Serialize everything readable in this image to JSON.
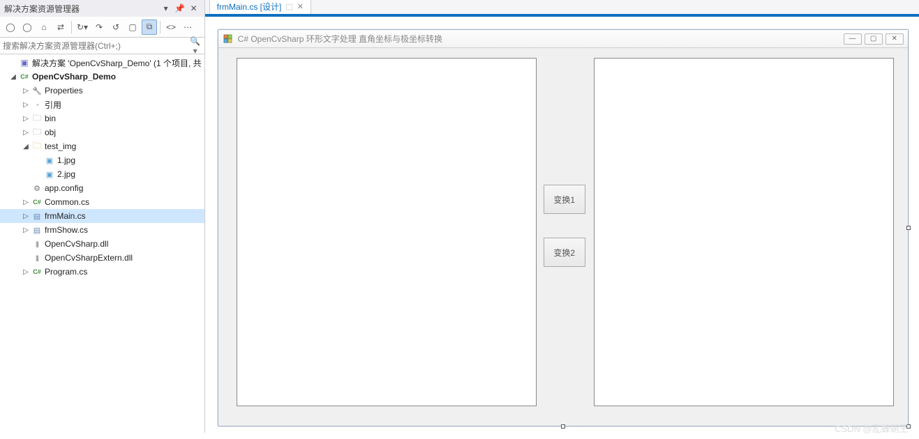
{
  "solutionExplorer": {
    "title": "解决方案资源管理器",
    "searchPlaceholder": "搜索解决方案资源管理器(Ctrl+;)",
    "toolbarIcons": [
      "back",
      "fwd",
      "home",
      "sync",
      "refresh",
      "collapse",
      "restore",
      "show-all",
      "view-code",
      "properties"
    ],
    "tree": [
      {
        "depth": 0,
        "arrow": "none",
        "iconCls": "ico-sol",
        "label": "解决方案 'OpenCvSharp_Demo' (1 个项目, 共",
        "bold": false,
        "sel": false
      },
      {
        "depth": 0,
        "arrow": "open",
        "iconCls": "ico-cs",
        "label": "OpenCvSharp_Demo",
        "bold": true,
        "sel": false
      },
      {
        "depth": 1,
        "arrow": "closed",
        "iconCls": "ico-prop",
        "label": "Properties",
        "bold": false,
        "sel": false
      },
      {
        "depth": 1,
        "arrow": "closed",
        "iconCls": "ico-ref",
        "label": "引用",
        "bold": false,
        "sel": false
      },
      {
        "depth": 1,
        "arrow": "closed",
        "iconCls": "ico-folderd",
        "label": "bin",
        "bold": false,
        "sel": false
      },
      {
        "depth": 1,
        "arrow": "closed",
        "iconCls": "ico-folderd",
        "label": "obj",
        "bold": false,
        "sel": false
      },
      {
        "depth": 1,
        "arrow": "open",
        "iconCls": "ico-folder",
        "label": "test_img",
        "bold": false,
        "sel": false
      },
      {
        "depth": 2,
        "arrow": "none",
        "iconCls": "ico-img",
        "label": "1.jpg",
        "bold": false,
        "sel": false
      },
      {
        "depth": 2,
        "arrow": "none",
        "iconCls": "ico-img",
        "label": "2.jpg",
        "bold": false,
        "sel": false
      },
      {
        "depth": 1,
        "arrow": "none",
        "iconCls": "ico-cfg",
        "label": "app.config",
        "bold": false,
        "sel": false
      },
      {
        "depth": 1,
        "arrow": "closed",
        "iconCls": "ico-cs",
        "label": "Common.cs",
        "bold": false,
        "sel": false
      },
      {
        "depth": 1,
        "arrow": "closed",
        "iconCls": "ico-form",
        "label": "frmMain.cs",
        "bold": false,
        "sel": true
      },
      {
        "depth": 1,
        "arrow": "closed",
        "iconCls": "ico-form",
        "label": "frmShow.cs",
        "bold": false,
        "sel": false
      },
      {
        "depth": 1,
        "arrow": "none",
        "iconCls": "ico-dll",
        "label": "OpenCvSharp.dll",
        "bold": false,
        "sel": false
      },
      {
        "depth": 1,
        "arrow": "none",
        "iconCls": "ico-dll",
        "label": "OpenCvSharpExtern.dll",
        "bold": false,
        "sel": false
      },
      {
        "depth": 1,
        "arrow": "closed",
        "iconCls": "ico-cs",
        "label": "Program.cs",
        "bold": false,
        "sel": false
      }
    ]
  },
  "editor": {
    "tabLabel": "frmMain.cs [设计]",
    "formTitle": "C# OpenCvSharp 环形文字处理 直角坐标与极坐标转换",
    "button1": "变换1",
    "button2": "变换2"
  },
  "watermark": "CSDN @乱蜂朝王"
}
